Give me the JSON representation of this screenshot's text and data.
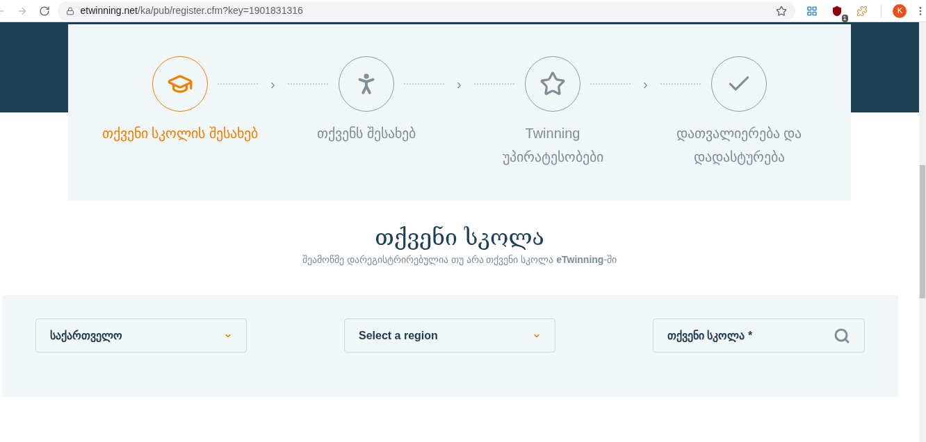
{
  "browser": {
    "url_host": "etwinning.net",
    "url_path": "/ka/pub/register.cfm?key=1901831316",
    "extension_badge": "1",
    "profile_initial": "K"
  },
  "steps": [
    {
      "label": "თქვენი სკოლის შესახებ",
      "selected": true
    },
    {
      "label": "თქვენს შესახებ",
      "selected": false
    },
    {
      "label": "Twinning უპირატესობები",
      "selected": false
    },
    {
      "label": "დათვალიერება და დადასტურება",
      "selected": false
    }
  ],
  "step_separator": "›",
  "section": {
    "title": "თქვენი სკოლა",
    "description": "შეამოწმე დარეგისტრირებულია თუ არა თქვენი სკოლა **eTwinning**-ში"
  },
  "fields": [
    {
      "kind": "select",
      "value": "საქართველო"
    },
    {
      "kind": "select",
      "value": "Select a region"
    },
    {
      "kind": "search",
      "placeholder": "თქვენი სკოლა *"
    }
  ]
}
